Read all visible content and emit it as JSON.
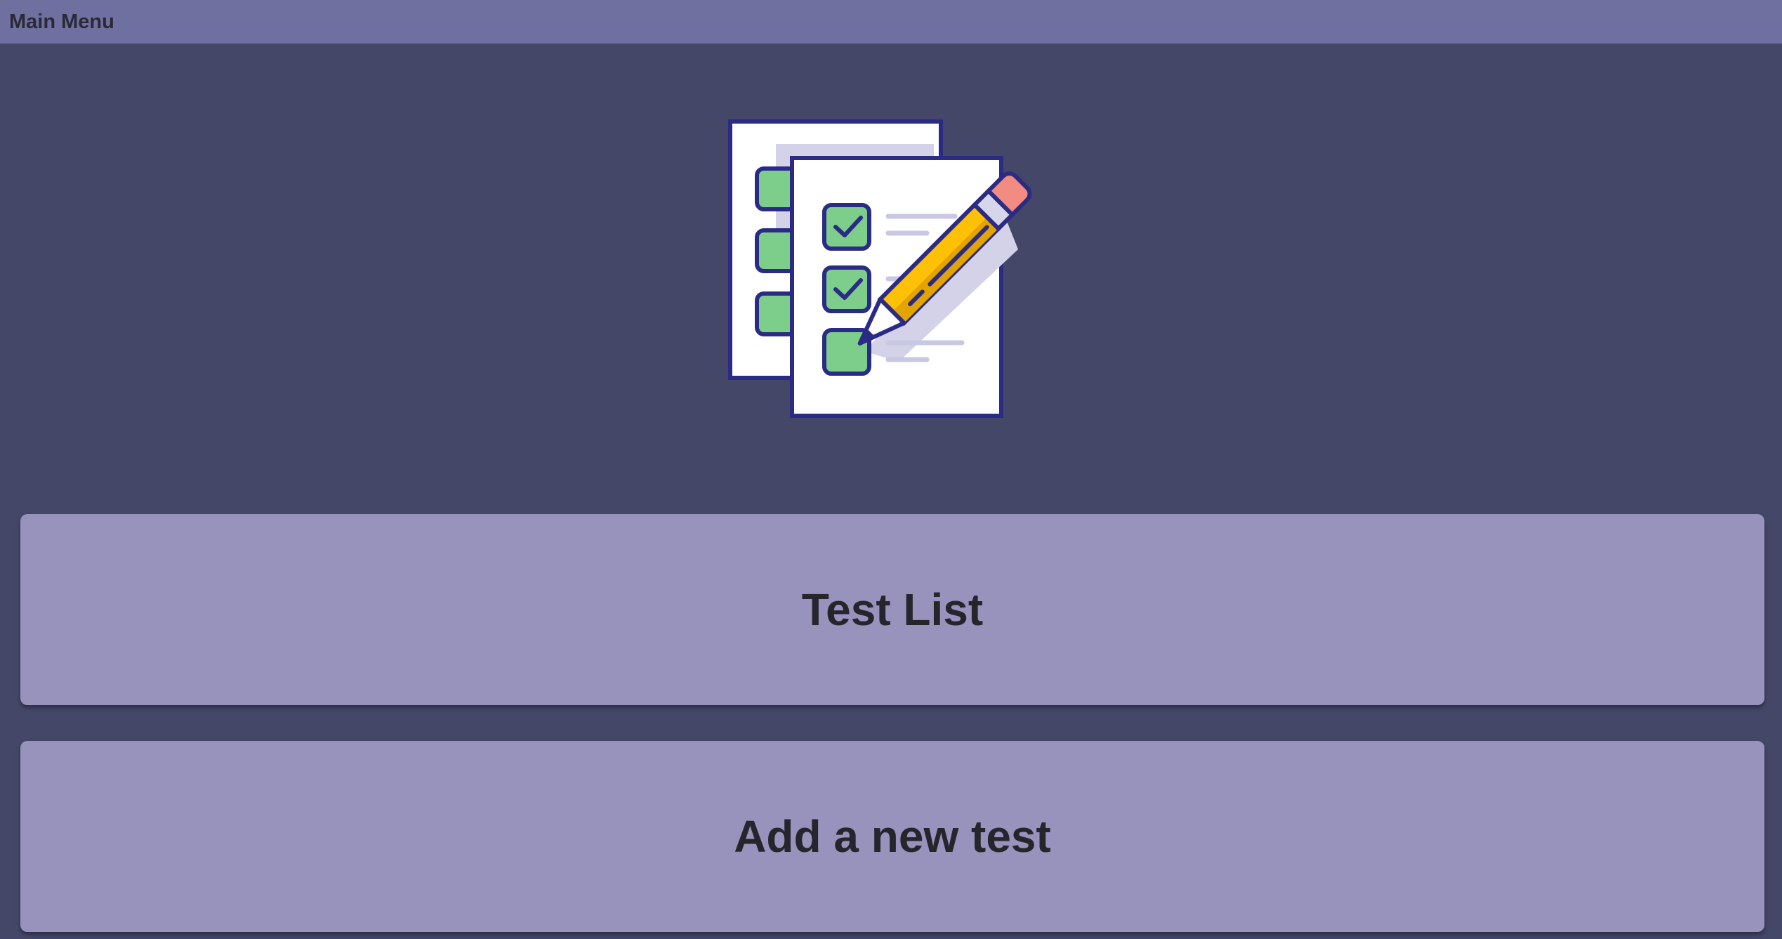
{
  "window": {
    "title": "Main Menu"
  },
  "hero": {
    "icon": "checklist-with-pencil-icon"
  },
  "menu": {
    "buttons": [
      {
        "label": "Test List"
      },
      {
        "label": "Add a new test"
      }
    ]
  },
  "colors": {
    "titlebar": "#6f70a0",
    "background": "#454769",
    "button": "#9793bd",
    "text": "#26252c",
    "check_green": "#7cce8a",
    "outline_navy": "#2b2b86",
    "pencil_yellow": "#ffc107",
    "eraser_pink": "#f28b82"
  }
}
